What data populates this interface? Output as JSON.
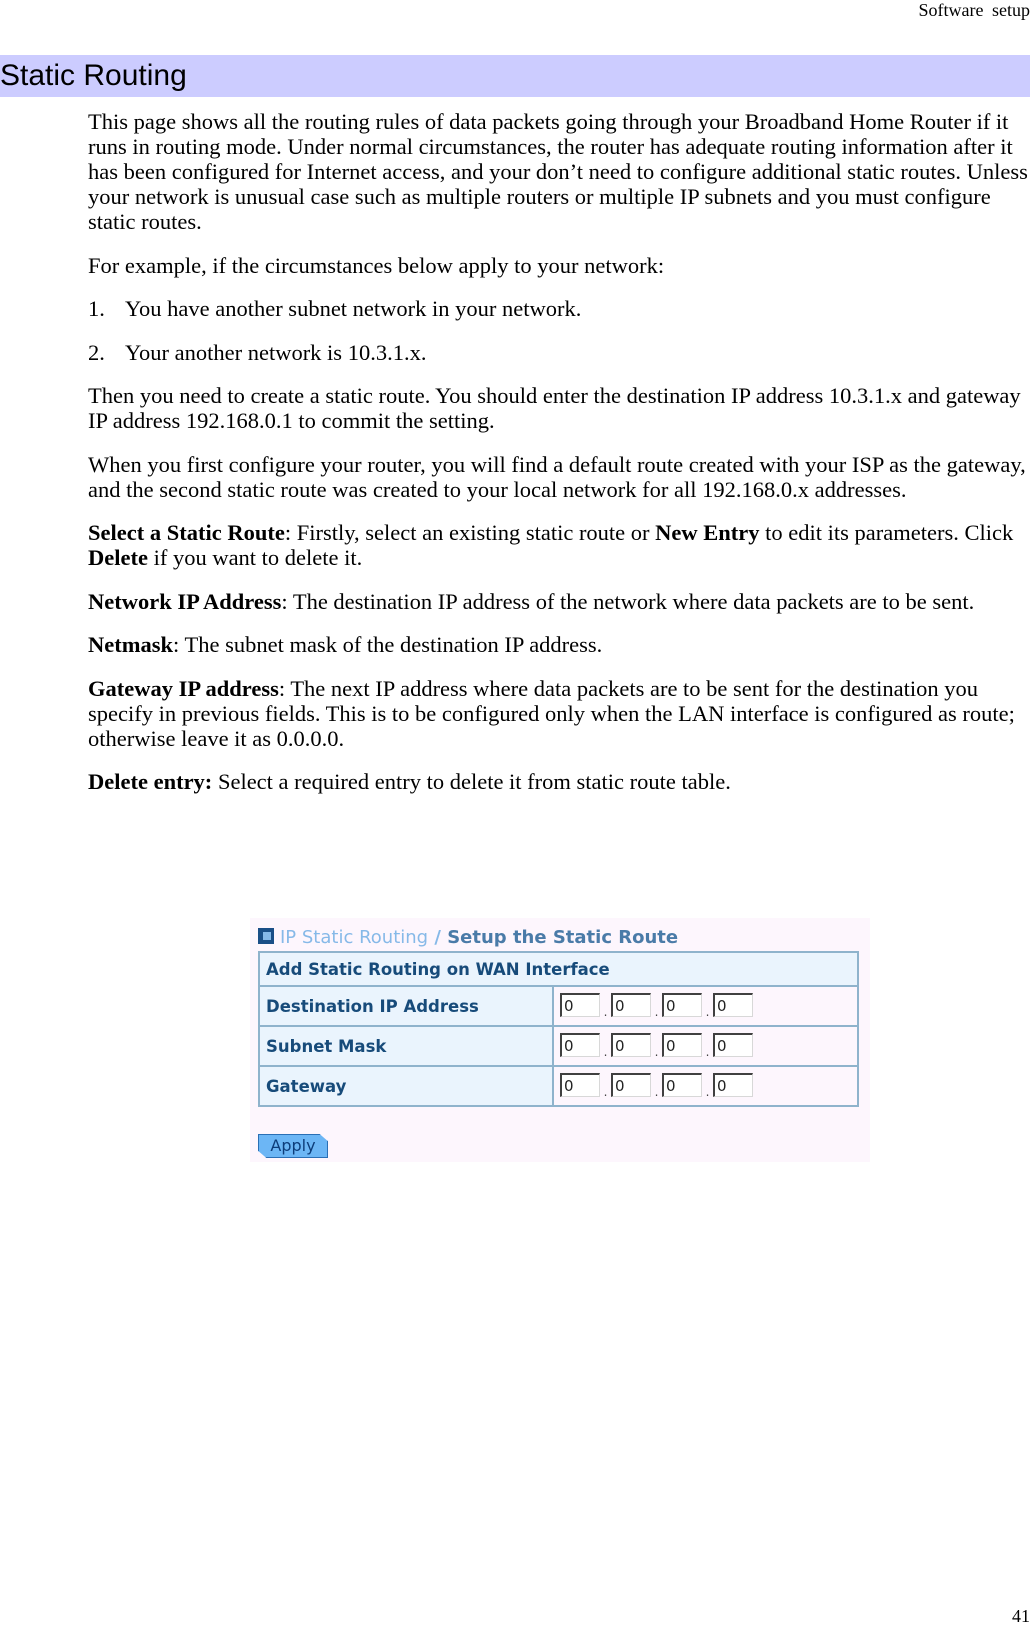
{
  "running_header": "Software  setup",
  "section_title": "Static Routing",
  "paragraphs": {
    "intro": "This page shows all the routing rules of data packets going through your Broadband Home Router if it runs in routing mode. Under normal circumstances, the router has adequate routing information after it has been configured for Internet access, and your don’t need to configure additional static routes. Unless your network is unusual case such as multiple routers or multiple IP subnets and you must configure static routes.",
    "example": "For example, if the circumstances below apply to your network:",
    "list": [
      {
        "num": "1.",
        "text": "You have another subnet network in your network."
      },
      {
        "num": "2.",
        "text": "Your another network is 10.3.1.x."
      }
    ],
    "then": "Then you need to create a static route. You should enter the destination IP address 10.3.1.x and gateway IP address 192.168.0.1 to commit the setting.",
    "first_config": "When you first configure your router, you will find a default route created with your ISP as the gateway, and the second static route was created to your local network for all 192.168.0.x addresses."
  },
  "definitions": {
    "select_route": {
      "term": "Select a Static Route",
      "t1": ": Firstly, select an existing static route or ",
      "b1": "New Entry",
      "t2": " to edit its parameters. Click ",
      "b2": "Delete",
      "t3": " if you want to delete it."
    },
    "network_ip": {
      "term": "Network IP Address",
      "text": ": The destination IP address of the network where data packets are to be sent."
    },
    "netmask": {
      "term": "Netmask",
      "text": ": The subnet mask of the destination IP address."
    },
    "gateway_ip": {
      "term": "Gateway IP address",
      "text": ": The next IP address where data packets are to be sent for the destination you specify in previous fields. This is to be configured only when the LAN interface is configured as route; otherwise leave it as 0.0.0.0."
    },
    "delete_entry": {
      "term": "Delete entry:",
      "text": " Select a required entry to delete it from static route table."
    }
  },
  "router_ui": {
    "breadcrumb_parent": "IP Static Routing",
    "breadcrumb_sep": " / ",
    "breadcrumb_current": "Setup the Static Route",
    "table_header": "Add Static Routing on WAN Interface",
    "rows": [
      {
        "label": "Destination IP Address",
        "octets": [
          "0",
          "0",
          "0",
          "0"
        ]
      },
      {
        "label": "Subnet Mask",
        "octets": [
          "0",
          "0",
          "0",
          "0"
        ]
      },
      {
        "label": "Gateway",
        "octets": [
          "0",
          "0",
          "0",
          "0"
        ]
      }
    ],
    "octet_separator": ".",
    "apply_label": "Apply"
  },
  "page_number": "41"
}
